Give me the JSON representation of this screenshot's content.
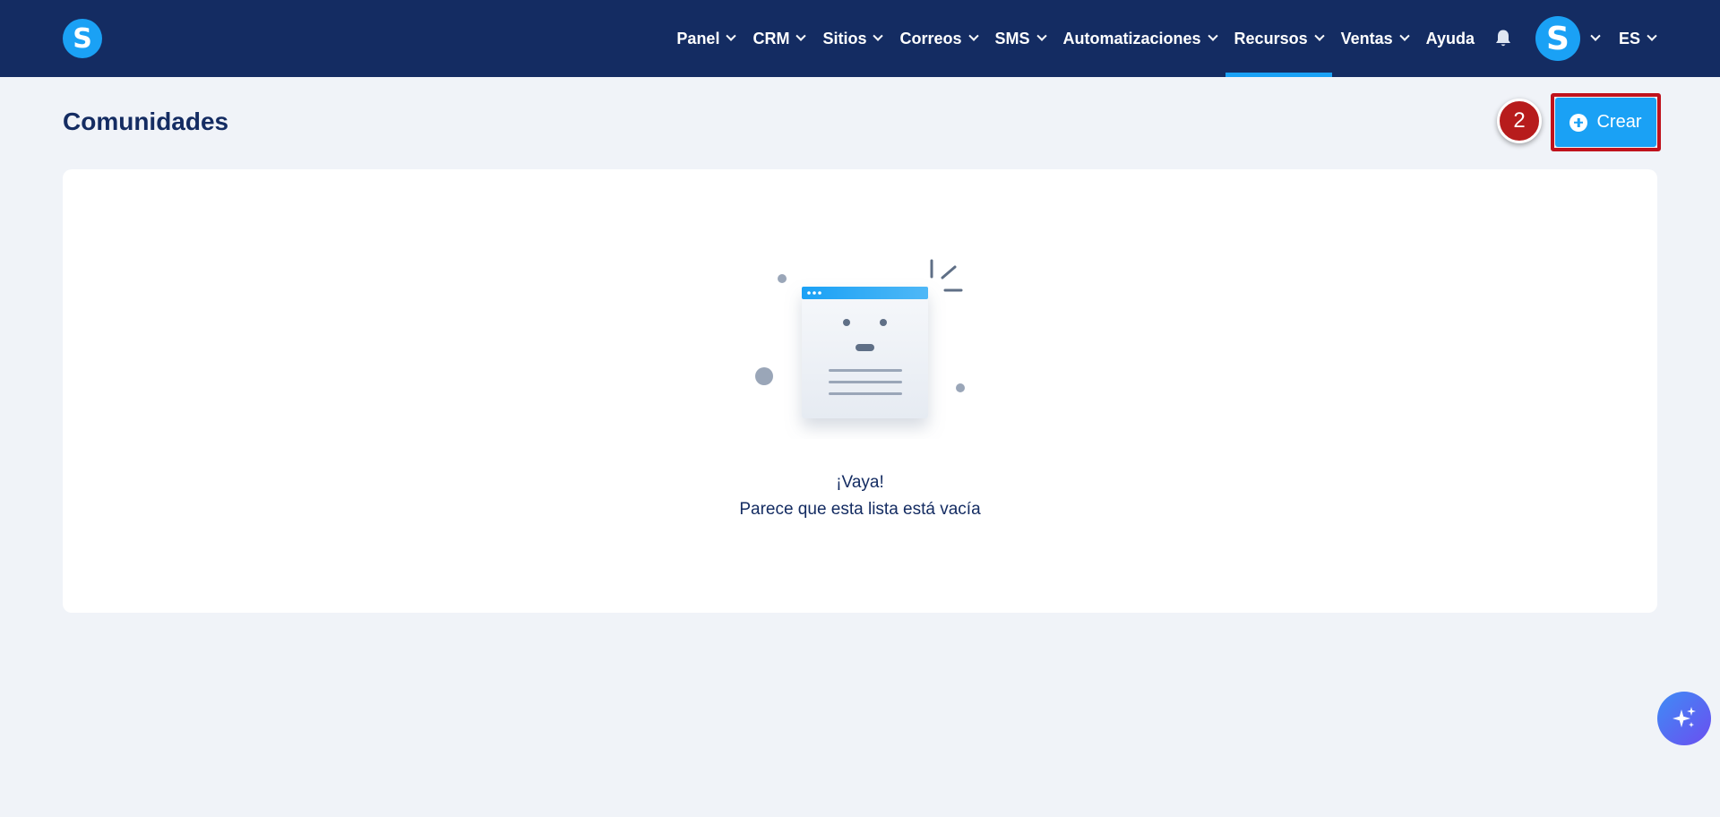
{
  "header": {
    "logo_letter": "S",
    "nav": [
      {
        "label": "Panel",
        "has_dropdown": true
      },
      {
        "label": "CRM",
        "has_dropdown": true
      },
      {
        "label": "Sitios",
        "has_dropdown": true
      },
      {
        "label": "Correos",
        "has_dropdown": true
      },
      {
        "label": "SMS",
        "has_dropdown": true
      },
      {
        "label": "Automatizaciones",
        "has_dropdown": true
      },
      {
        "label": "Recursos",
        "has_dropdown": true,
        "active": true
      },
      {
        "label": "Ventas",
        "has_dropdown": true
      },
      {
        "label": "Ayuda",
        "has_dropdown": false
      }
    ],
    "notification_icon": "bell-icon",
    "avatar_letter": "S",
    "language": "ES"
  },
  "page": {
    "title": "Comunidades",
    "step_badge": "2",
    "create_button_label": "Crear",
    "create_button_icon": "plus-circle-icon"
  },
  "empty_state": {
    "title": "¡Vaya!",
    "subtitle": "Parece que esta lista está vacía"
  },
  "fab": {
    "icon": "sparkles-icon"
  },
  "colors": {
    "topbar": "#142c62",
    "accent": "#1aa1f5",
    "background": "#f0f3f8",
    "highlight": "#c0121c",
    "badge": "#b71c1c"
  }
}
